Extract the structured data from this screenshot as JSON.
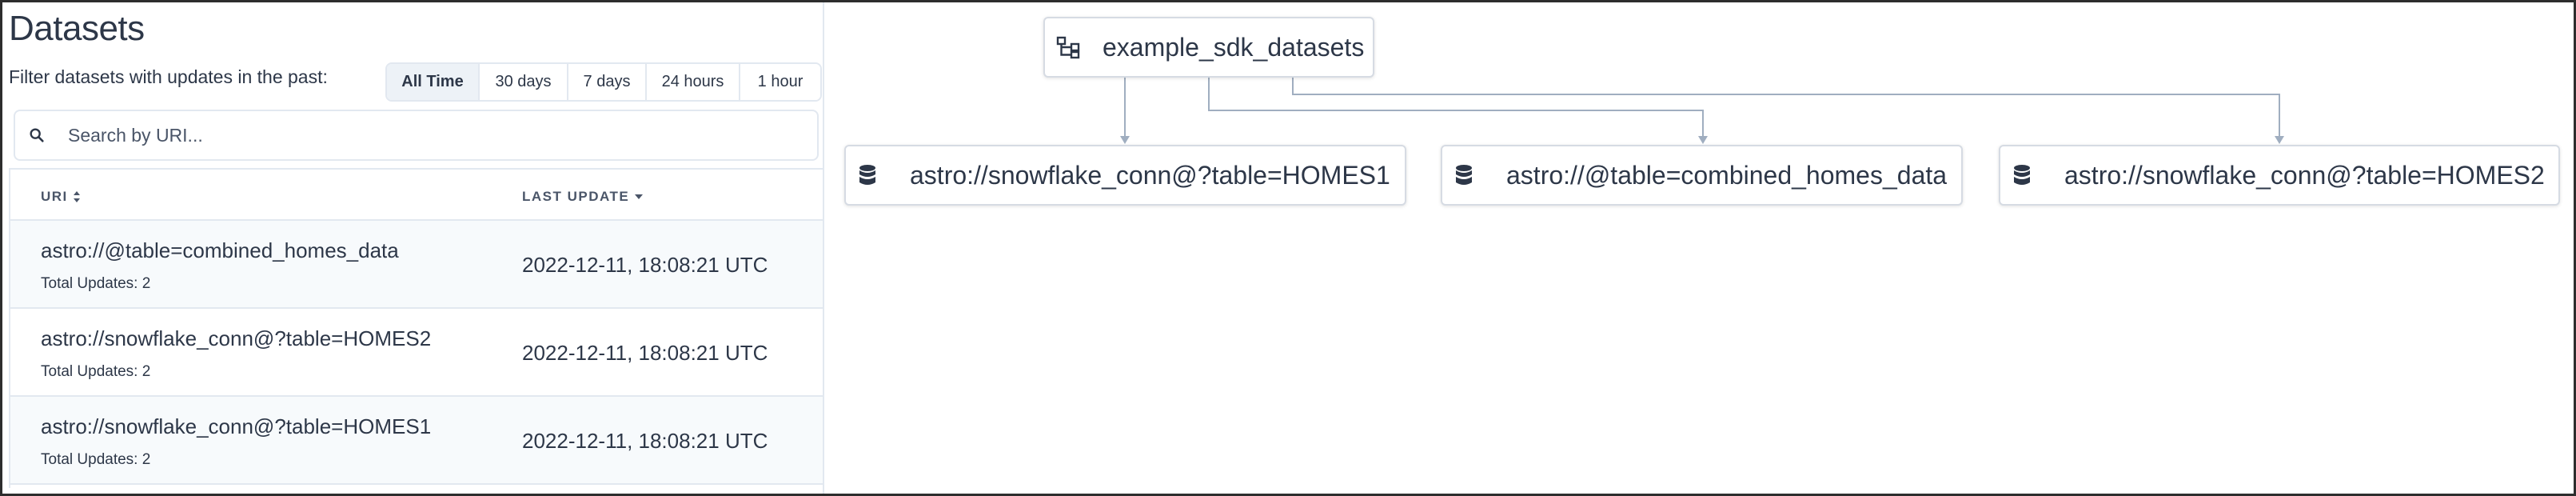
{
  "panel": {
    "title": "Datasets",
    "filter_label": "Filter datasets with updates in the past:",
    "filters": [
      {
        "label": "All Time",
        "active": true
      },
      {
        "label": "30 days",
        "active": false
      },
      {
        "label": "7 days",
        "active": false
      },
      {
        "label": "24 hours",
        "active": false
      },
      {
        "label": "1 hour",
        "active": false
      }
    ],
    "search_placeholder": "Search by URI...",
    "search_icon": "search-icon"
  },
  "table": {
    "headers": {
      "uri": "URI",
      "last_update": "LAST UPDATE"
    },
    "rows": [
      {
        "uri": "astro://@table=combined_homes_data",
        "updates": "Total Updates: 2",
        "date": "2022-12-11, 18:08:21 UTC"
      },
      {
        "uri": "astro://snowflake_conn@?table=HOMES2",
        "updates": "Total Updates: 2",
        "date": "2022-12-11, 18:08:21 UTC"
      },
      {
        "uri": "astro://snowflake_conn@?table=HOMES1",
        "updates": "Total Updates: 2",
        "date": "2022-12-11, 18:08:21 UTC"
      }
    ]
  },
  "graph": {
    "dag": {
      "label": "example_sdk_datasets",
      "icon": "dag-icon"
    },
    "datasets": [
      {
        "label": "astro://snowflake_conn@?table=HOMES1",
        "icon": "database-icon"
      },
      {
        "label": "astro://@table=combined_homes_data",
        "icon": "database-icon"
      },
      {
        "label": "astro://snowflake_conn@?table=HOMES2",
        "icon": "database-icon"
      }
    ],
    "edge_color": "#a0aec0"
  }
}
